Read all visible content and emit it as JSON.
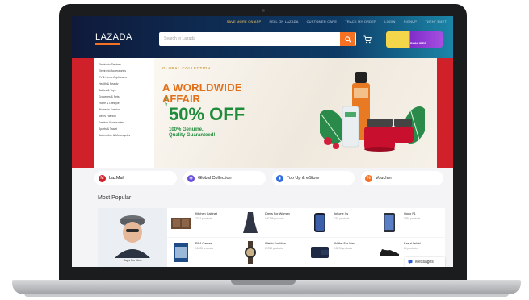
{
  "header": {
    "top_links": [
      "SAVE MORE ON APP",
      "SELL ON LAZADA",
      "CUSTOMER CARE",
      "TRACK MY ORDER",
      "LOGIN",
      "SIGNUP",
      "ТИЕНГ ВИЕТ"
    ],
    "logo": "LAZADA",
    "search_placeholder": "Search in Lazada",
    "promo_label": "BONUSES"
  },
  "sidebar": {
    "items": [
      "Electronic Devices",
      "Electronic Accessories",
      "TV & Home Appliances",
      "Health & Beauty",
      "Babies & Toys",
      "Groceries & Pets",
      "Home & Lifestyle",
      "Women's Fashion",
      "Men's Fashion",
      "Fashion Accessories",
      "Sports & Travel",
      "Automotive & Motorcycles"
    ]
  },
  "banner": {
    "tag": "GLOBAL COLLECTION",
    "line1": "A WORLDWIDE",
    "line2": "AFFAIR",
    "upto": "UP TO",
    "discount": "50% OFF",
    "note1": "100% Genuine,",
    "note2": "Quality Guaranteed!"
  },
  "categories": [
    {
      "label": "LazMall",
      "icon": "lazmall-icon",
      "color": "#d0202a"
    },
    {
      "label": "Global Collection",
      "icon": "globe-icon",
      "color": "#6a4fd6"
    },
    {
      "label": "Top Up & eStore",
      "icon": "topup-icon",
      "color": "#2f6de0"
    },
    {
      "label": "Voucher",
      "icon": "voucher-icon",
      "color": "#f57224"
    }
  ],
  "most_popular": {
    "title": "Most Popular",
    "feature": {
      "name": "Caps For Men"
    },
    "items": [
      {
        "name": "Kitchen Cabinet",
        "count": "3234 products"
      },
      {
        "name": "Dress For Women",
        "count": "100736 products"
      },
      {
        "name": "Iphone Xs",
        "count": "753 products"
      },
      {
        "name": "Oppo F1",
        "count": "1350 products"
      },
      {
        "name": "PS4 Games",
        "count": "15428 products"
      },
      {
        "name": "Watch For Men",
        "count": "28784 products"
      },
      {
        "name": "Wallet For Men",
        "count": "13876 products"
      },
      {
        "name": "Kasut Lelaki",
        "count": "14 products"
      }
    ]
  },
  "messages_label": "Messages"
}
